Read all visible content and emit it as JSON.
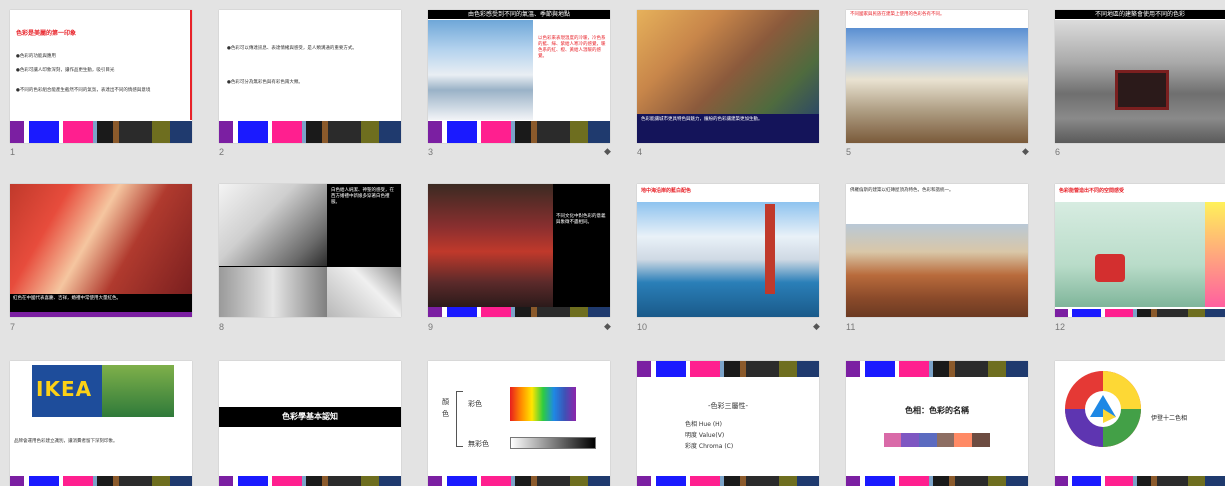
{
  "slides": [
    {
      "num": "1",
      "title": "色彩是美麗的第一印象",
      "lines": [
        "●色彩的功能與應用",
        "●色彩可讓人印象深刻，讓作品更生動，吸引目光",
        "●不同的色彩組合能產生截然不同的氣氛，表達出不同的情感與意境"
      ]
    },
    {
      "num": "2",
      "lines": [
        "●色彩可以傳達訊息、表達情緒與感受，是人類溝通的重要方式。",
        "●色彩可分為無彩色與有彩色兩大類。"
      ]
    },
    {
      "num": "3",
      "mark": "◆",
      "header": "由色彩感受到不同的氣溫、季節與地點",
      "side": "以色彩來表現溫度的冷暖，冷色系的藍、綠、紫給人寒冷的感覺，暖色系的紅、橙、黃給人溫暖的感覺。"
    },
    {
      "num": "4",
      "caption": "色彩能讓城市更具特色與魅力，繽紛的色彩讓建築更加生動。"
    },
    {
      "num": "5",
      "mark": "◆",
      "text": "不同國家與民族在建築上使用的色彩各有不同。"
    },
    {
      "num": "6",
      "header": "不同地區的建築會使用不同的色彩"
    },
    {
      "num": "7",
      "caption": "紅色在中國代表喜慶、吉祥，婚禮中常使用大量紅色。"
    },
    {
      "num": "8",
      "side": "白色給人純潔、神聖的感受，在西方婚禮中新娘多穿著白色禮服。"
    },
    {
      "num": "9",
      "mark": "◆",
      "side": "不同文化中對色彩的意義與象徵不盡相同。"
    },
    {
      "num": "10",
      "mark": "◆",
      "title": "地中海沿岸的藍白配色"
    },
    {
      "num": "11",
      "text": "佛羅倫斯的建築以紅磚屋頂為特色，色彩和諧統一。"
    },
    {
      "num": "12",
      "title": "色彩能營造出不同的空間感受"
    },
    {
      "num": "",
      "logo": "IKEA",
      "text": "品牌會運用色彩建立識別，讓消費者留下深刻印象。"
    },
    {
      "num": "",
      "banner": "色彩學基本認知"
    },
    {
      "num": "",
      "main": "顏色",
      "chromatic": "彩色",
      "achromatic": "無彩色"
    },
    {
      "num": "",
      "heading": "-色彩三屬性-",
      "items": [
        "色相 Hue (H)",
        "明度 Value(V)",
        "彩度 Chroma (C)"
      ]
    },
    {
      "num": "",
      "heading": "色相：色彩的名稱"
    },
    {
      "num": "",
      "text": "伊登十二色相"
    }
  ],
  "colors": {
    "strip": [
      "#7b1fa2",
      "#ffffff",
      "#1a1aff",
      "#ffffff",
      "#ff1f8f",
      "#7ba3c9",
      "#1a1a1a",
      "#8b5a2b",
      "#2b2b2b",
      "#6e6e1f",
      "#1f3a6e"
    ],
    "stripShort": [
      "#7b1fa2",
      "#ffffff",
      "#1a1aff",
      "#ffffff",
      "#ff1f8f",
      "#ffd400",
      "#7ba3c9",
      "#8b5a2b",
      "#1f3a6e"
    ],
    "accent": "#e8232a"
  }
}
